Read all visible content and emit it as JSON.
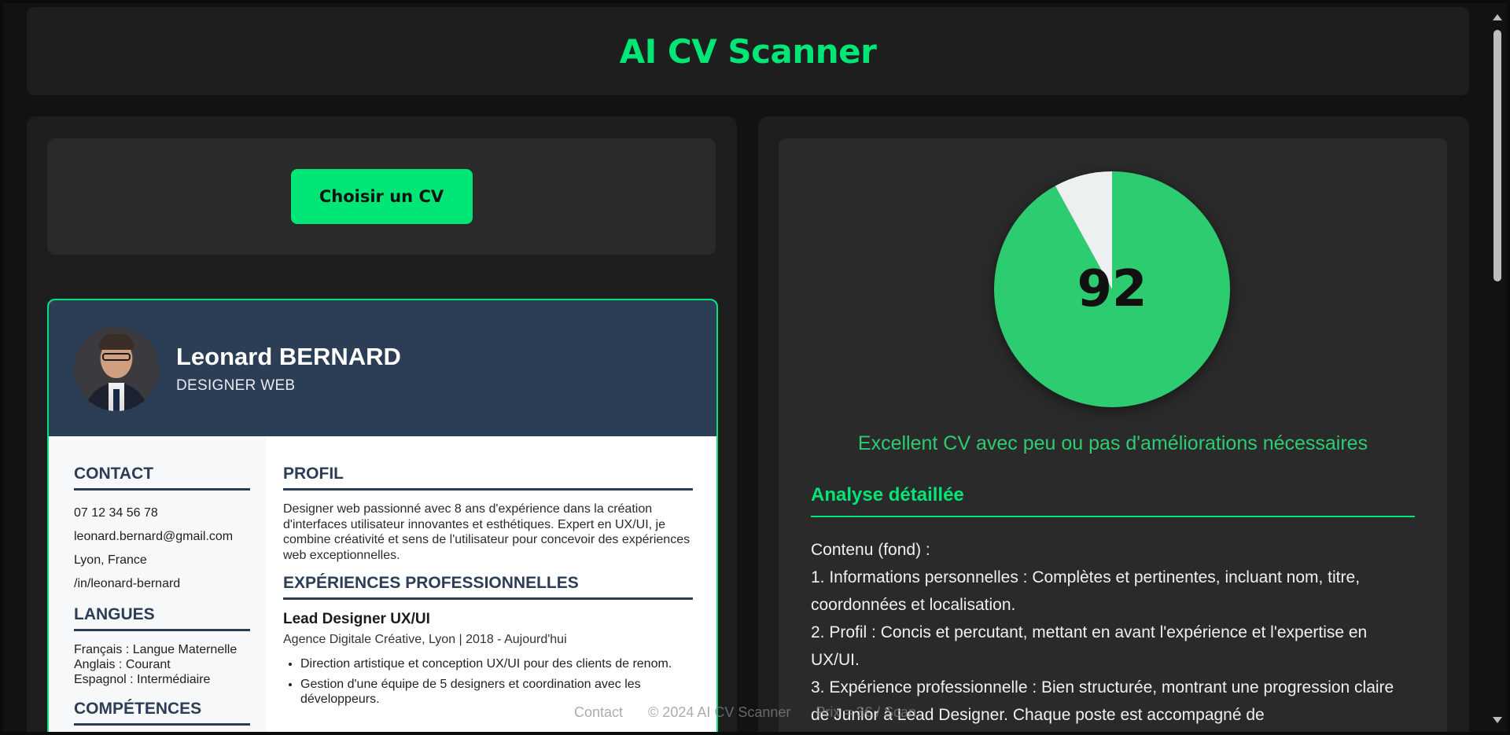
{
  "app": {
    "title": "AI CV Scanner"
  },
  "upload": {
    "button_label": "Choisir un CV"
  },
  "cv": {
    "name": "Leonard BERNARD",
    "job_title": "DESIGNER WEB",
    "contact": {
      "heading": "CONTACT",
      "phone": "07 12 34 56 78",
      "email": "leonard.bernard@gmail.com",
      "location": "Lyon, France",
      "linkedin": "/in/leonard-bernard"
    },
    "languages": {
      "heading": "LANGUES",
      "items": [
        "Français : Langue Maternelle",
        "Anglais : Courant",
        "Espagnol : Intermédiaire"
      ]
    },
    "skills": {
      "heading": "COMPÉTENCES"
    },
    "profile": {
      "heading": "PROFIL",
      "text": "Designer web passionné avec 8 ans d'expérience dans la création d'interfaces utilisateur innovantes et esthétiques. Expert en UX/UI, je combine créativité et sens de l'utilisateur pour concevoir des expériences web exceptionnelles."
    },
    "experience": {
      "heading": "EXPÉRIENCES PROFESSIONNELLES",
      "jobs": [
        {
          "title": "Lead Designer UX/UI",
          "meta": "Agence Digitale Créative, Lyon | 2018 - Aujourd'hui",
          "bullets": [
            "Direction artistique et conception UX/UI pour des clients de renom.",
            "Gestion d'une équipe de 5 designers et coordination avec les développeurs."
          ]
        }
      ]
    }
  },
  "score": {
    "value": "92",
    "verdict": "Excellent CV avec peu ou pas d'améliorations nécessaires",
    "fill_color": "#2ecc71",
    "rest_color": "#ecf0f1"
  },
  "chart_data": {
    "type": "pie",
    "values": [
      92,
      8
    ]
  },
  "analysis": {
    "heading": "Analyse détaillée",
    "lines": [
      "Contenu (fond) :",
      "1. Informations personnelles : Complètes et pertinentes, incluant nom, titre, coordonnées et localisation.",
      "2. Profil : Concis et percutant, mettant en avant l'expérience et l'expertise en UX/UI.",
      "3. Expérience professionnelle : Bien structurée, montrant une progression claire de Junior à Lead Designer. Chaque poste est accompagné de"
    ]
  },
  "footer": {
    "contact": "Contact",
    "copyright": "© 2024 AI CV Scanner",
    "price": "Prix = 3€ / Scan"
  }
}
